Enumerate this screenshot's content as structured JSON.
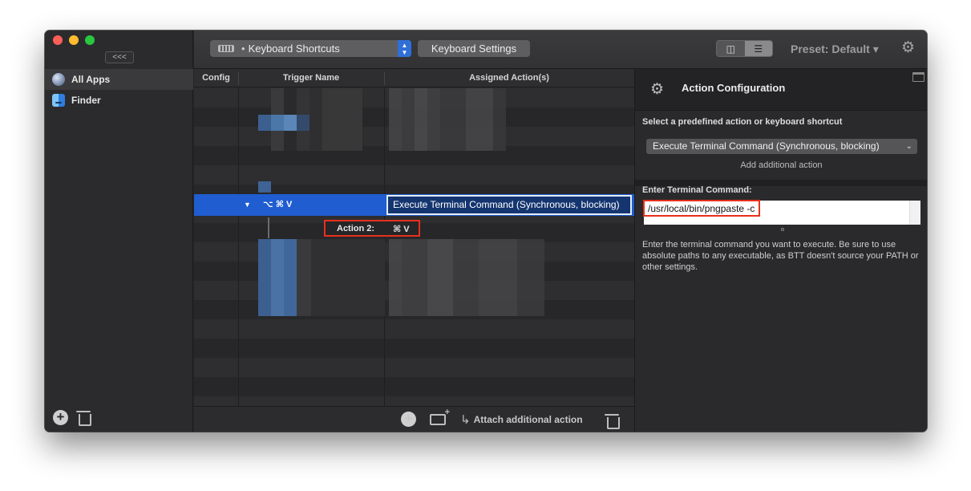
{
  "sidebar": {
    "collapse_label": "<<<",
    "apps": [
      {
        "label": "All Apps",
        "icon": "globe-icon",
        "selected": true
      },
      {
        "label": "Finder",
        "icon": "finder-icon",
        "selected": false
      }
    ]
  },
  "toolbar": {
    "trigger_type": "Keyboard Shortcuts",
    "settings_button": "Keyboard Settings",
    "preset": "Preset: Default ▾"
  },
  "table": {
    "headers": {
      "config": "Config",
      "trigger": "Trigger Name",
      "action": "Assigned Action(s)"
    },
    "selected_row": {
      "expand": "▼",
      "trigger": "⌥ ⌘ V",
      "action": "Execute Terminal Command (Synchronous, blocking)"
    },
    "sub_action": {
      "label": "Action 2:",
      "shortcut": "⌘ V"
    },
    "footer": {
      "attach_label": "Attach additional action"
    }
  },
  "config_panel": {
    "title": "Action Configuration",
    "select_hint": "Select a predefined action or keyboard shortcut",
    "selected_action": "Execute Terminal Command (Synchronous, blocking)",
    "add_action": "Add additional action",
    "command_label": "Enter Terminal Command:",
    "command_value": "/usr/local/bin/pngpaste -c",
    "help_text": "Enter the terminal command you want to execute. Be sure to use absolute paths to any executable, as BTT doesn't source your PATH or other settings."
  },
  "colors": {
    "selection": "#1f5dd0",
    "highlight": "#e8301c",
    "select_accent": "#2f6fd8"
  }
}
